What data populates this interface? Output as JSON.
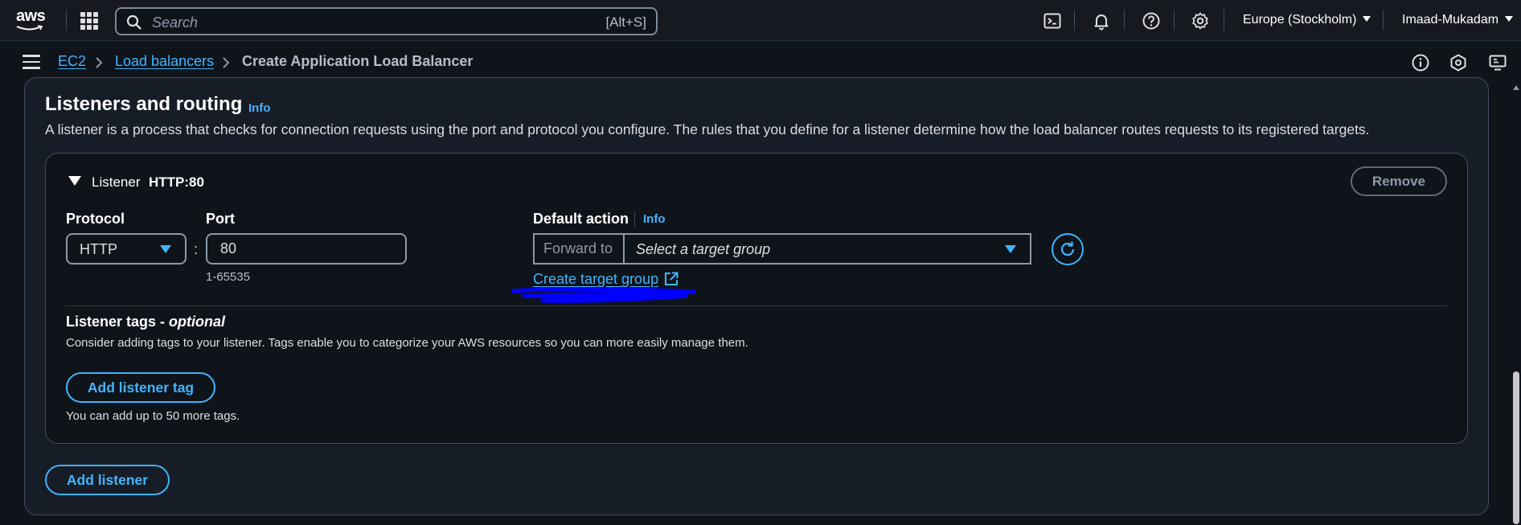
{
  "topnav": {
    "logo_text": "aws",
    "search_placeholder": "Search",
    "search_shortcut": "[Alt+S]",
    "icons": [
      "cloudshell-icon",
      "bell-icon",
      "help-icon",
      "settings-icon"
    ],
    "region": "Europe (Stockholm)",
    "account": "Imaad-Mukadam"
  },
  "breadcrumb": {
    "items": [
      "EC2",
      "Load balancers",
      "Create Application Load Balancer"
    ],
    "right_icons": [
      "info-icon",
      "notifications-icon",
      "display-icon"
    ]
  },
  "section": {
    "title": "Listeners and routing",
    "info": "Info",
    "description": "A listener is a process that checks for connection requests using the port and protocol you configure. The rules that you define for a listener determine how the load balancer routes requests to its registered targets."
  },
  "listener": {
    "label": "Listener",
    "value": "HTTP:80",
    "remove_label": "Remove",
    "protocol_label": "Protocol",
    "protocol_value": "HTTP",
    "port_label": "Port",
    "port_value": "80",
    "port_hint": "1-65535",
    "default_action_label": "Default action",
    "default_action_info": "Info",
    "forward_label": "Forward to",
    "target_group_placeholder": "Select a target group",
    "create_target_group": "Create target group"
  },
  "tags": {
    "title": "Listener tags - ",
    "title_optional": "optional",
    "description": "Consider adding tags to your listener. Tags enable you to categorize your AWS resources so you can more easily manage them.",
    "add_button": "Add listener tag",
    "note": "You can add up to 50 more tags."
  },
  "add_listener_label": "Add listener",
  "colors": {
    "accent": "#42b4ff",
    "background": "#0f141a",
    "panel": "#161d26",
    "border": "#414d5c",
    "annotation": "#0000ff"
  }
}
